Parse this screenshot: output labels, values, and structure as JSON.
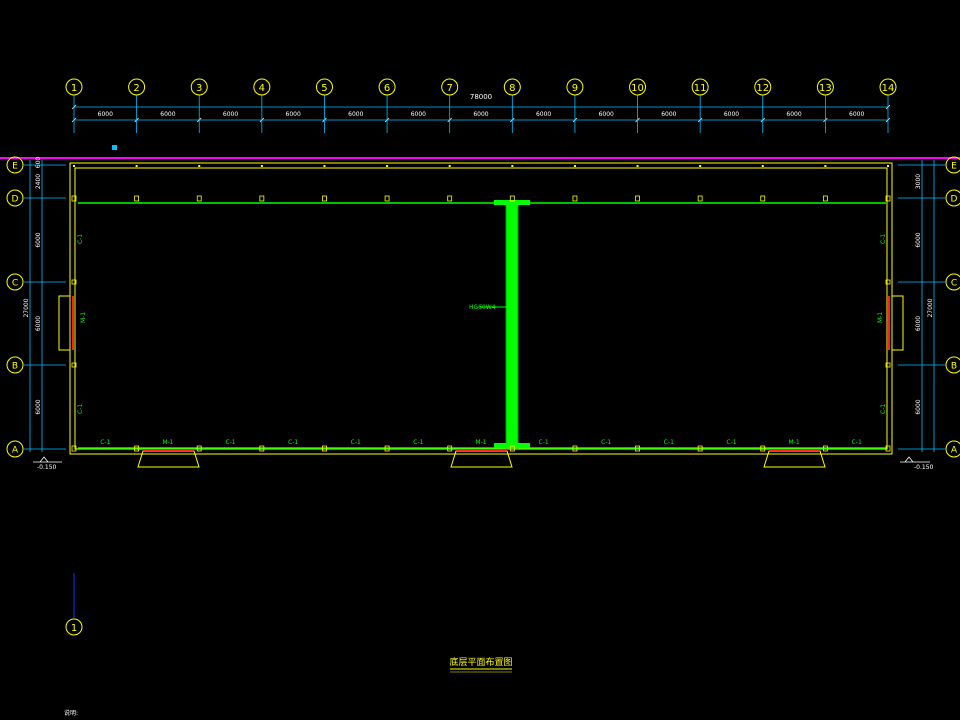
{
  "drawing": {
    "title": "底层平面布置图",
    "note": "说明:",
    "total_dim": "78000",
    "bay_dims": [
      "6000",
      "6000",
      "6000",
      "6000",
      "6000",
      "6000",
      "6000",
      "6000",
      "6000",
      "6000",
      "6000",
      "6000",
      "6000"
    ],
    "axis_numbers": [
      "1",
      "2",
      "3",
      "4",
      "5",
      "6",
      "7",
      "8",
      "9",
      "10",
      "11",
      "12",
      "13",
      " 14"
    ],
    "axis_letters": [
      "E",
      "D",
      "C",
      "B",
      "A"
    ],
    "left_dims": [
      "600",
      "2400",
      "6000",
      "6000",
      "6000"
    ],
    "left_total": "27000",
    "right_dims": [
      "3000",
      "6000",
      "6000",
      "6000"
    ],
    "right_total": "27000",
    "level_left": "-0.150",
    "level_right": "-0.150",
    "wall_label": "HG60W4",
    "door_label": "M-1",
    "window_left_right_top": "C-1",
    "window_left_right_bottom": "C-1",
    "bottom_openings": [
      "C-1",
      "M-1",
      "C-1",
      "C-1",
      "C-1",
      "C-1",
      "M-1",
      "C-1",
      "C-1",
      "C-1",
      "C-1",
      "M-1",
      "C-1"
    ],
    "lone_axis": "1",
    "colors": {
      "frame": "#ffff00",
      "axis": "#00c0ff",
      "wall": "#00ff00",
      "magenta": "#ff00ff",
      "red": "#ff2020",
      "white": "#ffffff"
    }
  }
}
